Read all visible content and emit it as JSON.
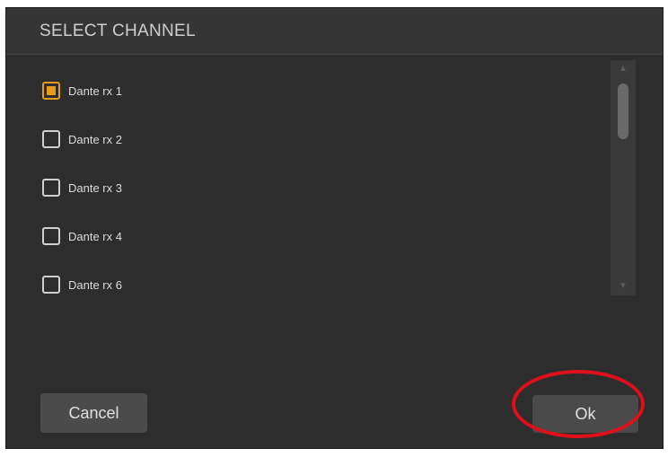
{
  "dialog": {
    "title": "SELECT CHANNEL"
  },
  "channels": [
    {
      "label": "Dante rx 1",
      "checked": true
    },
    {
      "label": "Dante rx 2",
      "checked": false
    },
    {
      "label": "Dante rx 3",
      "checked": false
    },
    {
      "label": "Dante rx 4",
      "checked": false
    },
    {
      "label": "Dante rx 6",
      "checked": false
    }
  ],
  "buttons": {
    "cancel_label": "Cancel",
    "ok_label": "Ok"
  },
  "scrollbar": {
    "up_icon": "triangle-up-icon",
    "down_icon": "triangle-down-icon"
  },
  "colors": {
    "accent": "#e59b1c",
    "highlight_ring": "#e0101a",
    "dialog_bg": "#2d2d2d"
  }
}
